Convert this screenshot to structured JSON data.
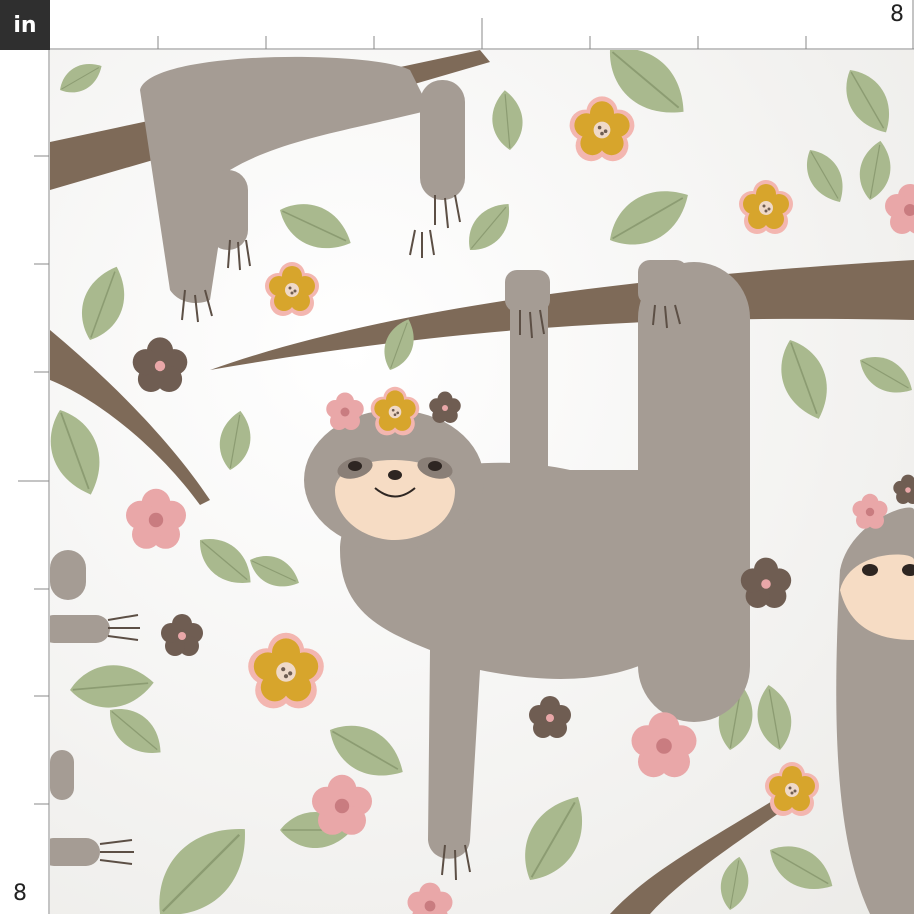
{
  "ruler": {
    "unit_label": "in",
    "top_end_label": "8",
    "left_end_label": "8"
  },
  "fabric": {
    "palette": {
      "background": "#fbfbf8",
      "sloth_body": "#a59c94",
      "sloth_face": "#f6dcc4",
      "branch": "#7e6a58",
      "leaf": "#a9b98e",
      "flower_pink": "#e9a7a8",
      "flower_yellow": "#d7a52c",
      "flower_brown": "#6f5d52"
    }
  }
}
